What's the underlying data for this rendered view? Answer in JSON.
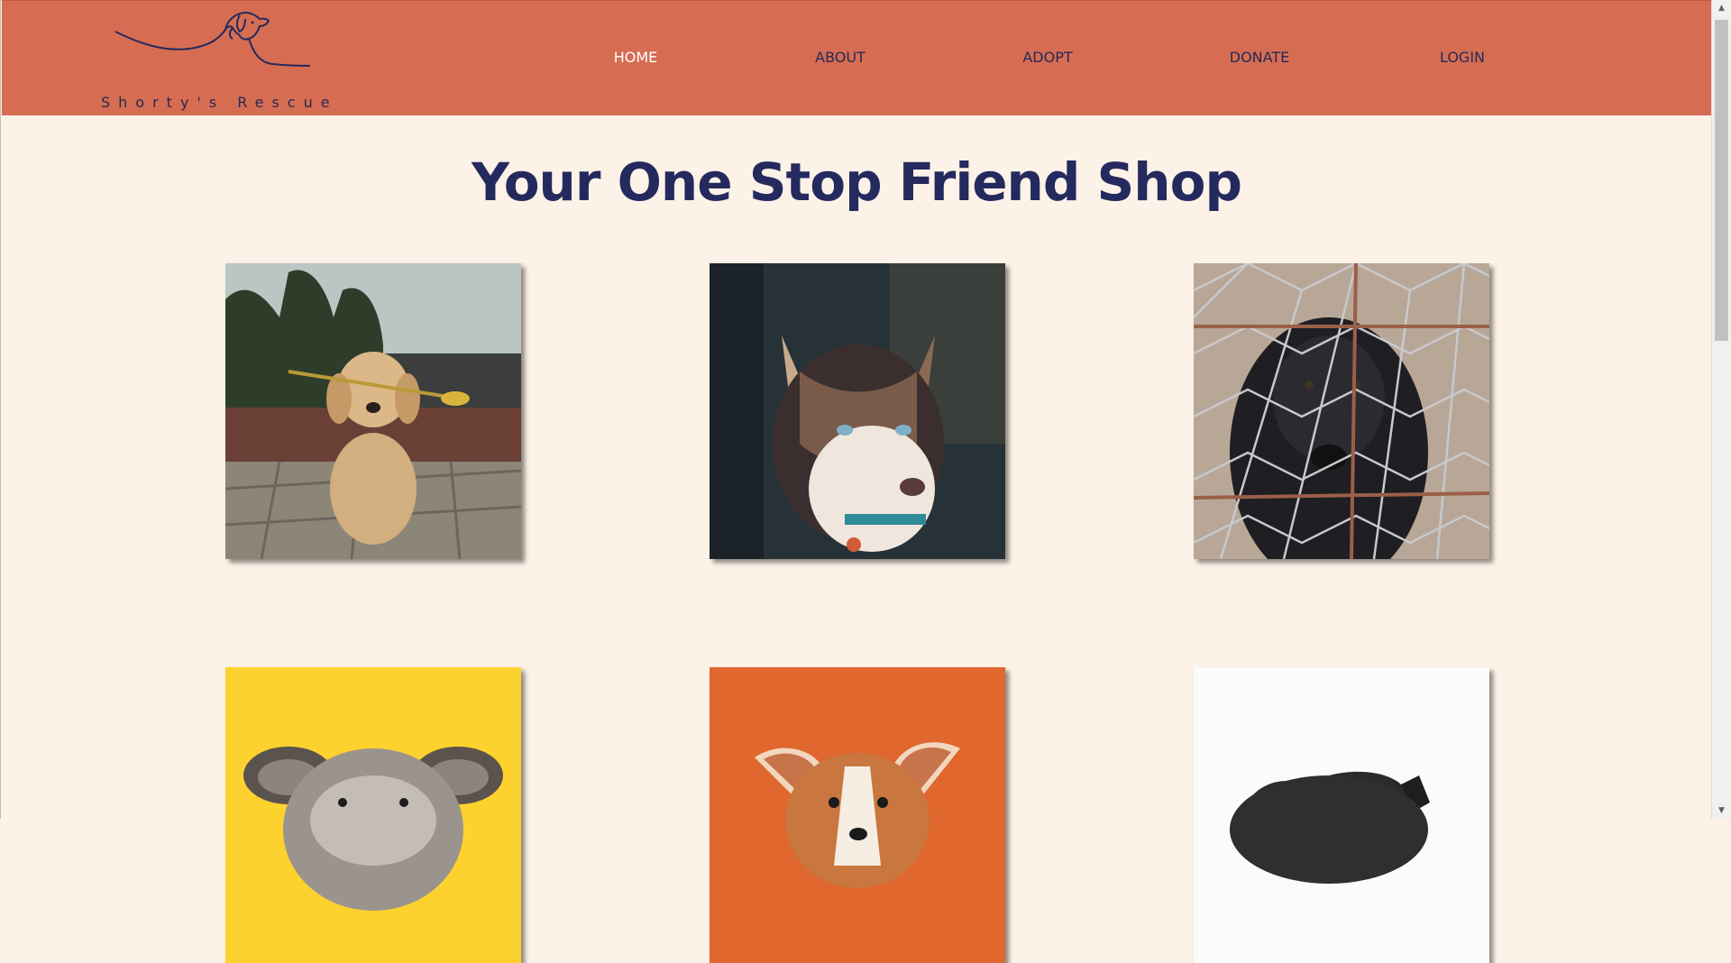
{
  "brand": {
    "name": "Shorty's Rescue",
    "logo_icon": "dog-line-drawing-icon"
  },
  "nav": {
    "items": [
      {
        "label": "HOME",
        "active": true
      },
      {
        "label": "ABOUT",
        "active": false
      },
      {
        "label": "ADOPT",
        "active": false
      },
      {
        "label": "DONATE",
        "active": false
      },
      {
        "label": "LOGIN",
        "active": false
      }
    ]
  },
  "main": {
    "headline": "Your One Stop Friend Shop",
    "dogs": [
      {
        "name": "golden-retriever-puppy-with-flower-photo"
      },
      {
        "name": "husky-blue-eyes-photo"
      },
      {
        "name": "black-dog-behind-fence-photo"
      },
      {
        "name": "schnauzer-on-yellow-photo"
      },
      {
        "name": "corgi-on-orange-photo"
      },
      {
        "name": "black-dog-on-white-photo"
      }
    ]
  },
  "colors": {
    "header": "#d66d53",
    "background": "#fdf2e7",
    "navy": "#252a5e",
    "nav_active": "#ffffff"
  }
}
